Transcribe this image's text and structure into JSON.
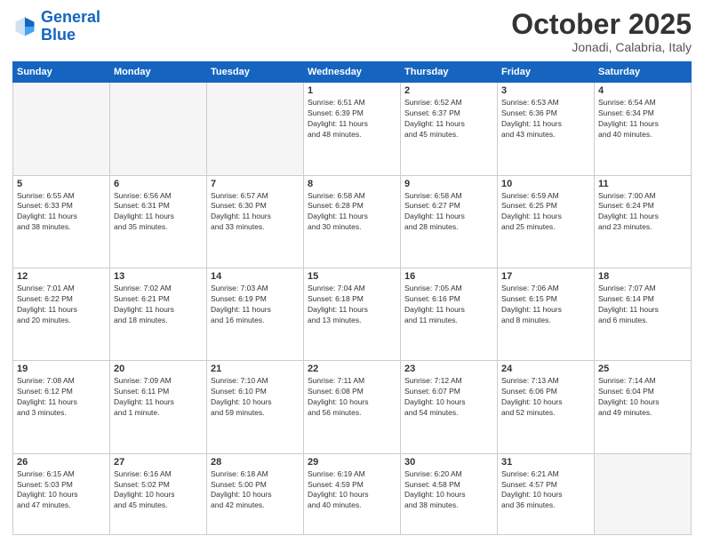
{
  "header": {
    "logo_general": "General",
    "logo_blue": "Blue",
    "month_title": "October 2025",
    "location": "Jonadi, Calabria, Italy"
  },
  "days_of_week": [
    "Sunday",
    "Monday",
    "Tuesday",
    "Wednesday",
    "Thursday",
    "Friday",
    "Saturday"
  ],
  "weeks": [
    [
      {
        "day": "",
        "info": ""
      },
      {
        "day": "",
        "info": ""
      },
      {
        "day": "",
        "info": ""
      },
      {
        "day": "1",
        "info": "Sunrise: 6:51 AM\nSunset: 6:39 PM\nDaylight: 11 hours\nand 48 minutes."
      },
      {
        "day": "2",
        "info": "Sunrise: 6:52 AM\nSunset: 6:37 PM\nDaylight: 11 hours\nand 45 minutes."
      },
      {
        "day": "3",
        "info": "Sunrise: 6:53 AM\nSunset: 6:36 PM\nDaylight: 11 hours\nand 43 minutes."
      },
      {
        "day": "4",
        "info": "Sunrise: 6:54 AM\nSunset: 6:34 PM\nDaylight: 11 hours\nand 40 minutes."
      }
    ],
    [
      {
        "day": "5",
        "info": "Sunrise: 6:55 AM\nSunset: 6:33 PM\nDaylight: 11 hours\nand 38 minutes."
      },
      {
        "day": "6",
        "info": "Sunrise: 6:56 AM\nSunset: 6:31 PM\nDaylight: 11 hours\nand 35 minutes."
      },
      {
        "day": "7",
        "info": "Sunrise: 6:57 AM\nSunset: 6:30 PM\nDaylight: 11 hours\nand 33 minutes."
      },
      {
        "day": "8",
        "info": "Sunrise: 6:58 AM\nSunset: 6:28 PM\nDaylight: 11 hours\nand 30 minutes."
      },
      {
        "day": "9",
        "info": "Sunrise: 6:58 AM\nSunset: 6:27 PM\nDaylight: 11 hours\nand 28 minutes."
      },
      {
        "day": "10",
        "info": "Sunrise: 6:59 AM\nSunset: 6:25 PM\nDaylight: 11 hours\nand 25 minutes."
      },
      {
        "day": "11",
        "info": "Sunrise: 7:00 AM\nSunset: 6:24 PM\nDaylight: 11 hours\nand 23 minutes."
      }
    ],
    [
      {
        "day": "12",
        "info": "Sunrise: 7:01 AM\nSunset: 6:22 PM\nDaylight: 11 hours\nand 20 minutes."
      },
      {
        "day": "13",
        "info": "Sunrise: 7:02 AM\nSunset: 6:21 PM\nDaylight: 11 hours\nand 18 minutes."
      },
      {
        "day": "14",
        "info": "Sunrise: 7:03 AM\nSunset: 6:19 PM\nDaylight: 11 hours\nand 16 minutes."
      },
      {
        "day": "15",
        "info": "Sunrise: 7:04 AM\nSunset: 6:18 PM\nDaylight: 11 hours\nand 13 minutes."
      },
      {
        "day": "16",
        "info": "Sunrise: 7:05 AM\nSunset: 6:16 PM\nDaylight: 11 hours\nand 11 minutes."
      },
      {
        "day": "17",
        "info": "Sunrise: 7:06 AM\nSunset: 6:15 PM\nDaylight: 11 hours\nand 8 minutes."
      },
      {
        "day": "18",
        "info": "Sunrise: 7:07 AM\nSunset: 6:14 PM\nDaylight: 11 hours\nand 6 minutes."
      }
    ],
    [
      {
        "day": "19",
        "info": "Sunrise: 7:08 AM\nSunset: 6:12 PM\nDaylight: 11 hours\nand 3 minutes."
      },
      {
        "day": "20",
        "info": "Sunrise: 7:09 AM\nSunset: 6:11 PM\nDaylight: 11 hours\nand 1 minute."
      },
      {
        "day": "21",
        "info": "Sunrise: 7:10 AM\nSunset: 6:10 PM\nDaylight: 10 hours\nand 59 minutes."
      },
      {
        "day": "22",
        "info": "Sunrise: 7:11 AM\nSunset: 6:08 PM\nDaylight: 10 hours\nand 56 minutes."
      },
      {
        "day": "23",
        "info": "Sunrise: 7:12 AM\nSunset: 6:07 PM\nDaylight: 10 hours\nand 54 minutes."
      },
      {
        "day": "24",
        "info": "Sunrise: 7:13 AM\nSunset: 6:06 PM\nDaylight: 10 hours\nand 52 minutes."
      },
      {
        "day": "25",
        "info": "Sunrise: 7:14 AM\nSunset: 6:04 PM\nDaylight: 10 hours\nand 49 minutes."
      }
    ],
    [
      {
        "day": "26",
        "info": "Sunrise: 6:15 AM\nSunset: 5:03 PM\nDaylight: 10 hours\nand 47 minutes."
      },
      {
        "day": "27",
        "info": "Sunrise: 6:16 AM\nSunset: 5:02 PM\nDaylight: 10 hours\nand 45 minutes."
      },
      {
        "day": "28",
        "info": "Sunrise: 6:18 AM\nSunset: 5:00 PM\nDaylight: 10 hours\nand 42 minutes."
      },
      {
        "day": "29",
        "info": "Sunrise: 6:19 AM\nSunset: 4:59 PM\nDaylight: 10 hours\nand 40 minutes."
      },
      {
        "day": "30",
        "info": "Sunrise: 6:20 AM\nSunset: 4:58 PM\nDaylight: 10 hours\nand 38 minutes."
      },
      {
        "day": "31",
        "info": "Sunrise: 6:21 AM\nSunset: 4:57 PM\nDaylight: 10 hours\nand 36 minutes."
      },
      {
        "day": "",
        "info": ""
      }
    ]
  ]
}
